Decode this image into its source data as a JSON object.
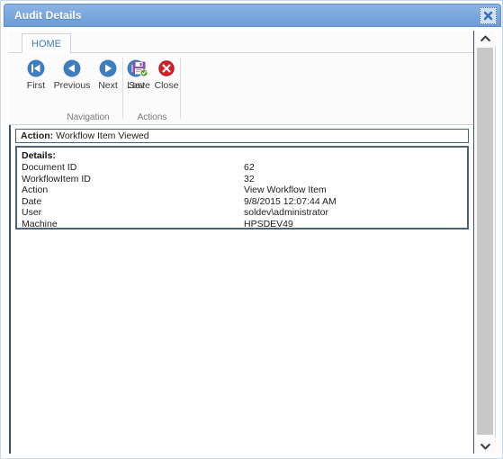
{
  "window": {
    "title": "Audit Details",
    "close_icon": "close-x-icon"
  },
  "ribbon": {
    "tabs": [
      {
        "label": "HOME",
        "name": "tab-home"
      }
    ],
    "groups": [
      {
        "label": "Navigation",
        "buttons": [
          {
            "label": "First",
            "icon": "skip-to-first-icon"
          },
          {
            "label": "Previous",
            "icon": "arrow-left-icon"
          },
          {
            "label": "Next",
            "icon": "arrow-right-icon"
          },
          {
            "label": "Last",
            "icon": "skip-to-last-icon"
          }
        ]
      },
      {
        "label": "Actions",
        "buttons": [
          {
            "label": "Save",
            "icon": "save-floppy-icon"
          },
          {
            "label": "Close",
            "icon": "close-circle-icon"
          }
        ]
      }
    ]
  },
  "content": {
    "action_bar": {
      "label": "Action:",
      "value": "Workflow Item Viewed"
    },
    "details": {
      "title": "Details:",
      "rows": [
        {
          "label": "Document ID",
          "value": "62"
        },
        {
          "label": "WorkflowItem ID",
          "value": "32"
        },
        {
          "label": "Action",
          "value": "View Workflow Item"
        },
        {
          "label": "Date",
          "value": "9/8/2015 12:07:44 AM"
        },
        {
          "label": "User",
          "value": "soldev\\administrator"
        },
        {
          "label": "Machine",
          "value": "HPSDEV49"
        }
      ]
    }
  },
  "scrollbar": {
    "up_icon": "chevron-up-icon",
    "down_icon": "chevron-down-icon"
  },
  "colors": {
    "titlebar": "#7aa7dd",
    "tab_text": "#3d77c2",
    "panel_border": "#4b6179",
    "nav_icon": "#3d7ebf",
    "save_icon": "#8e4fa8",
    "save_badge": "#4aa021",
    "close_icon": "#d81f2a",
    "scroll_thumb": "#c8c8c8"
  }
}
